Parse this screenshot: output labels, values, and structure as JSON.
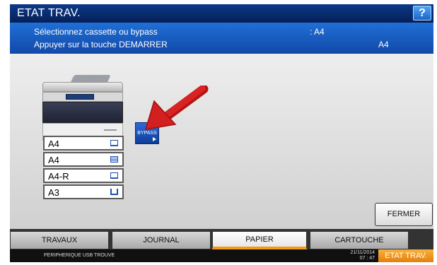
{
  "header": {
    "title": "ETAT TRAV.",
    "help_label": "?"
  },
  "message": {
    "line1": "Sélectionnez cassette ou bypass",
    "line1_value": ": A4",
    "line2": "Appuyer sur la touche DEMARRER",
    "line2_value": "A4"
  },
  "cassettes": [
    {
      "size": "A4",
      "level": "low"
    },
    {
      "size": "A4",
      "level": "full"
    },
    {
      "size": "A4-R",
      "level": "low"
    },
    {
      "size": "A3",
      "level": "empty"
    }
  ],
  "bypass": {
    "label": "BYPASS"
  },
  "buttons": {
    "close_label": "FERMER"
  },
  "tabs": [
    {
      "label": "TRAVAUX",
      "active": false
    },
    {
      "label": "JOURNAL",
      "active": false
    },
    {
      "label": "PAPIER",
      "active": true
    },
    {
      "label": "CARTOUCHE",
      "active": false
    }
  ],
  "status": {
    "message": "PERIPHERIQUE USB TROUVE",
    "date": "21/11/2014",
    "time": "07 : 47",
    "job_status_label": "ETAT TRAV."
  },
  "colors": {
    "title_bar": "#061f56",
    "message_bar": "#1a5cc4",
    "accent": "#f39a11",
    "arrow": "#d21f1f"
  },
  "icons": {
    "help": "question-icon",
    "pointer": "red-arrow-icon",
    "paper_level": "paper-level-icon"
  }
}
